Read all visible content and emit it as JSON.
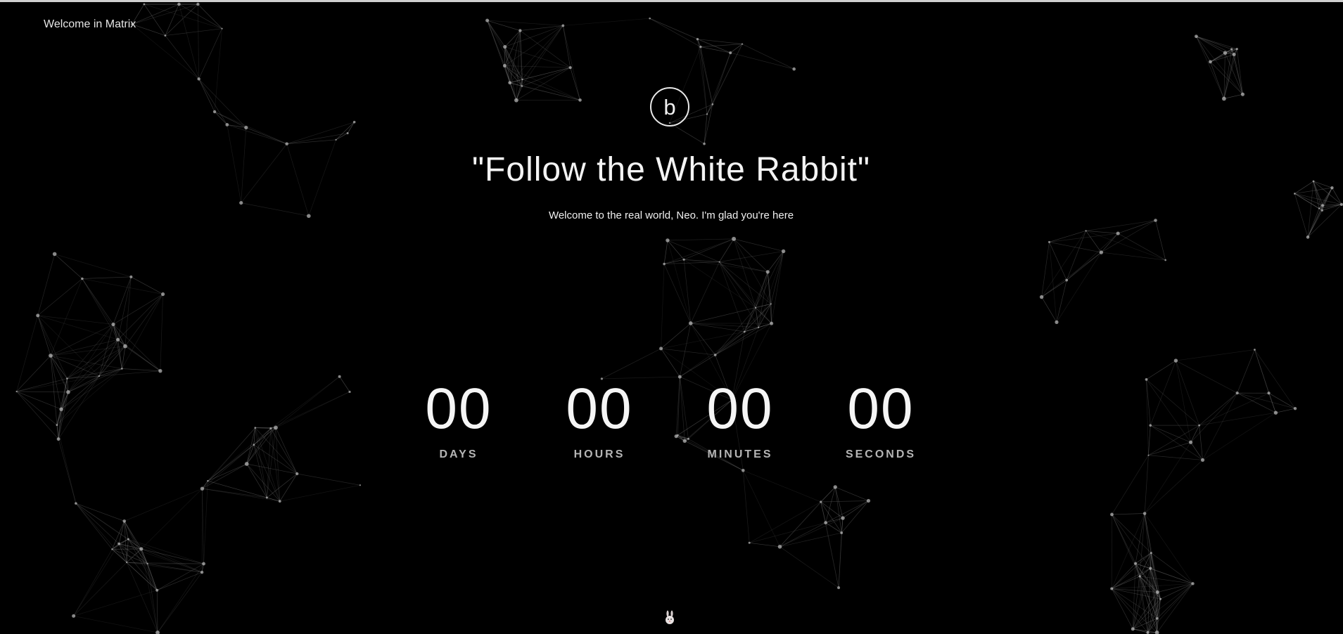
{
  "header": {
    "site_title": "Welcome in Matrix"
  },
  "hero": {
    "logo_letter": "b",
    "headline": "\"Follow the White Rabbit\"",
    "subtitle": "Welcome to the real world, Neo. I'm glad you're here"
  },
  "countdown": {
    "units": [
      {
        "value": "00",
        "label": "DAYS"
      },
      {
        "value": "00",
        "label": "HOURS"
      },
      {
        "value": "00",
        "label": "MINUTES"
      },
      {
        "value": "00",
        "label": "SECONDS"
      }
    ]
  },
  "theme": {
    "background": "#000000",
    "text": "#f4f4f4",
    "label_text": "#b5b5b5",
    "network_line": "#8a8a8a",
    "network_node": "#bdbdbd"
  },
  "icons": {
    "logo": "circle-b-logo-icon",
    "bottom": "white-rabbit-icon",
    "background": "particle-network-background"
  }
}
